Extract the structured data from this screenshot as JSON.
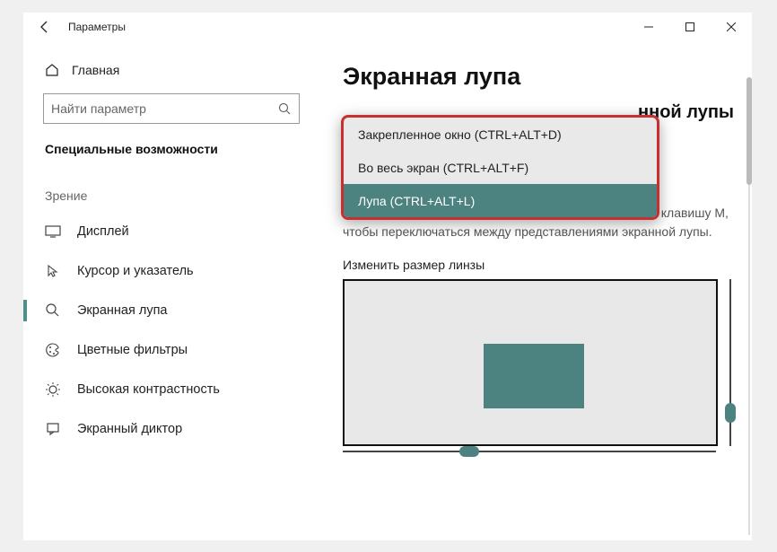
{
  "titlebar": {
    "title": "Параметры"
  },
  "sidebar": {
    "home": "Главная",
    "search_placeholder": "Найти параметр",
    "section": "Специальные возможности",
    "subhead": "Зрение",
    "items": [
      {
        "label": "Дисплей"
      },
      {
        "label": "Курсор и указатель"
      },
      {
        "label": "Экранная лупа"
      },
      {
        "label": "Цветные фильтры"
      },
      {
        "label": "Высокая контрастность"
      },
      {
        "label": "Экранный диктор"
      }
    ]
  },
  "main": {
    "title": "Экранная лупа",
    "partial_heading": "нной лупы",
    "hint": "Удерживая нажатыми клавиши CTRL+ALT нажимайте клавишу M, чтобы переключаться между представлениями экранной лупы.",
    "lens_label": "Изменить размер линзы"
  },
  "dropdown": {
    "options": [
      "Закрепленное окно (CTRL+ALT+D)",
      "Во весь экран (CTRL+ALT+F)",
      "Лупа (CTRL+ALT+L)"
    ],
    "selected_index": 2
  }
}
